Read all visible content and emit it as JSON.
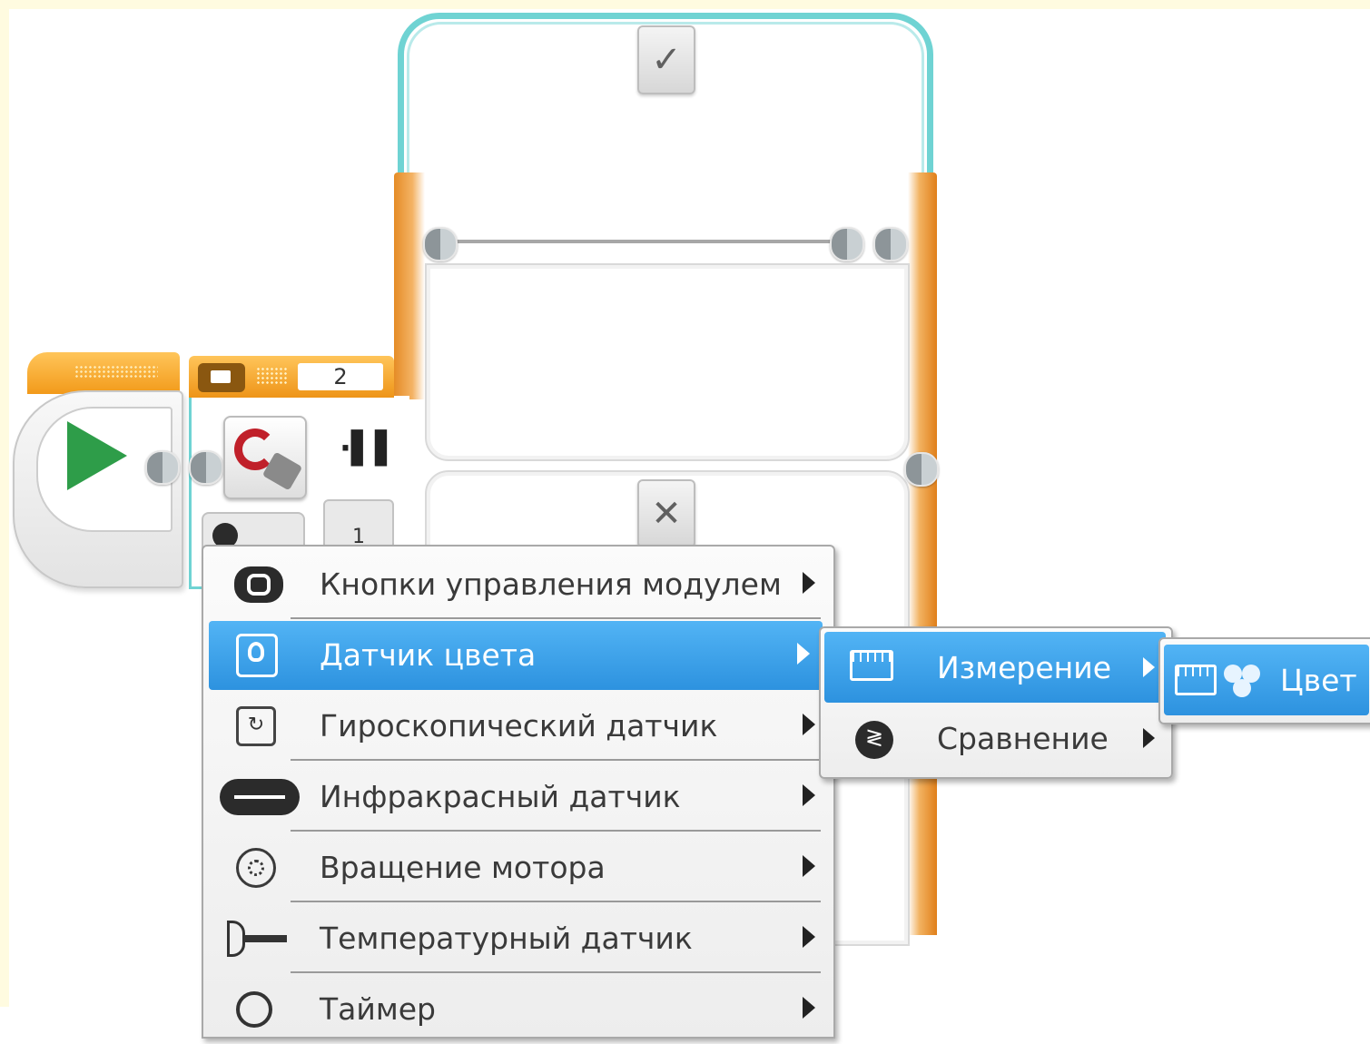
{
  "program": {
    "switch_port": "2",
    "port_tab_value": "1",
    "true_case_symbol": "✓",
    "false_case_symbol": "✕"
  },
  "main_menu": {
    "items": [
      {
        "label": "Кнопки управления модулем",
        "icon": "brick-buttons-icon",
        "selected": false
      },
      {
        "label": "Датчик цвета",
        "icon": "color-sensor-icon",
        "selected": true
      },
      {
        "label": "Гироскопический датчик",
        "icon": "gyro-sensor-icon",
        "selected": false
      },
      {
        "label": "Инфракрасный датчик",
        "icon": "infrared-sensor-icon",
        "selected": false
      },
      {
        "label": "Вращение мотора",
        "icon": "motor-rotation-icon",
        "selected": false
      },
      {
        "label": "Температурный датчик",
        "icon": "temperature-sensor-icon",
        "selected": false
      },
      {
        "label": "Таймер",
        "icon": "timer-icon",
        "selected": false
      }
    ]
  },
  "submenu": {
    "items": [
      {
        "label": "Измерение",
        "icon": "measure-icon",
        "selected": true
      },
      {
        "label": "Сравнение",
        "icon": "compare-icon",
        "selected": false
      }
    ]
  },
  "submenu2": {
    "items": [
      {
        "label": "Цвет",
        "icon": "color-mode-icon",
        "selected": true
      }
    ]
  },
  "colors": {
    "accent_blue": "#3a9fe8",
    "block_orange": "#f29a1a",
    "switch_teal": "#6fd3d3",
    "play_green": "#2e9d49",
    "loop_red": "#c0202a"
  }
}
